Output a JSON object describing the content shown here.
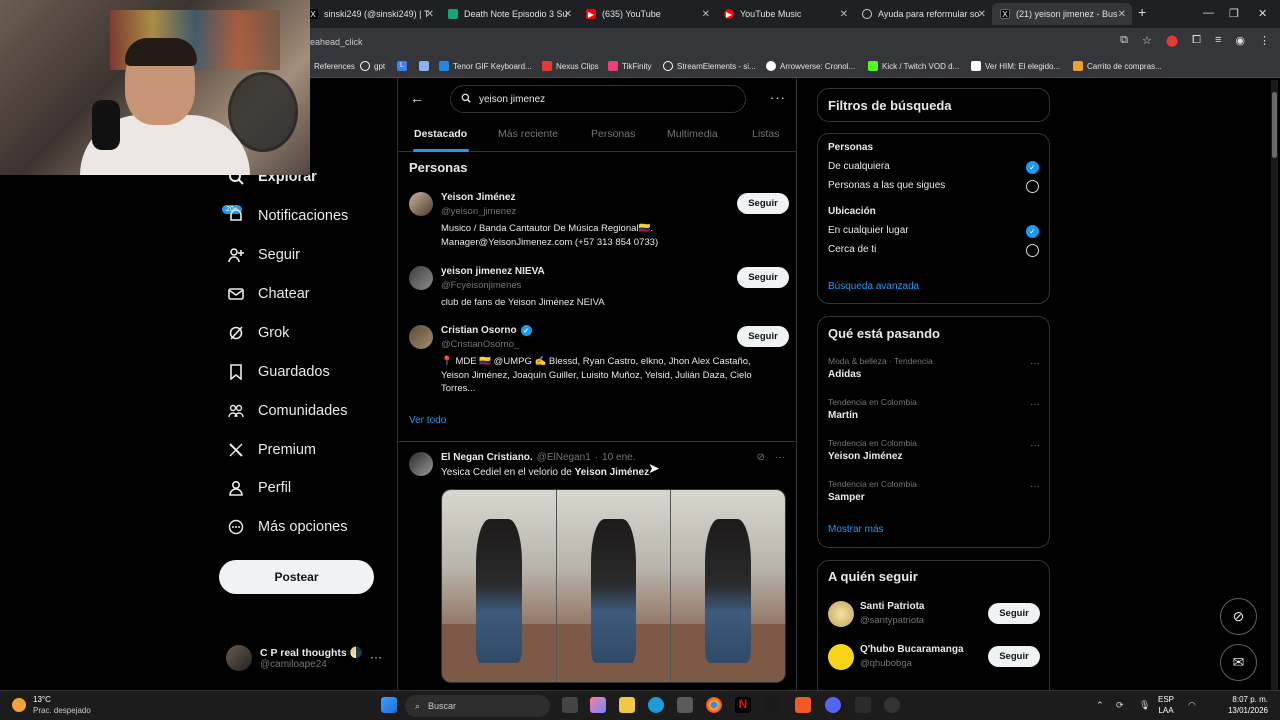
{
  "browser": {
    "tabs": [
      {
        "label": "sinski249 (@sinski249) | T",
        "favicon": "x-icon",
        "color": "#000000"
      },
      {
        "label": "Death Note Episodio 3 Su",
        "favicon": "tv-icon",
        "color": "#1aa37a"
      },
      {
        "label": "(635) YouTube",
        "favicon": "youtube-icon",
        "color": "#ff0000"
      },
      {
        "label": "YouTube Music",
        "favicon": "youtube-music-icon",
        "color": "#ff0000"
      },
      {
        "label": "Ayuda para reformular so",
        "favicon": "chatgpt-icon",
        "color": "#6e6e6e"
      },
      {
        "label": "(21) yeison jimenez - Bus",
        "favicon": "x-icon",
        "color": "#000000"
      }
    ],
    "url": "eahead_click",
    "bookmarks": [
      {
        "label": "References",
        "color": "#4285f4"
      },
      {
        "label": "gpt",
        "color": "#ffffff"
      },
      {
        "label": "L",
        "color": "#3b82f6"
      },
      {
        "label": "",
        "color": "#8ab4f8"
      },
      {
        "label": "Tenor GIF Keyboard...",
        "color": "#1e88e5"
      },
      {
        "label": "Nexus Clips",
        "color": "#e53935"
      },
      {
        "label": "TikFinity",
        "color": "#ec407a"
      },
      {
        "label": "StreamElements - si...",
        "color": "#ffffff"
      },
      {
        "label": "Arrowverse: Cronol...",
        "color": "#ffffff"
      },
      {
        "label": "Kick / Twitch VOD d...",
        "color": "#53fc18"
      },
      {
        "label": "Ver HIM: El elegido...",
        "color": "#ffffff"
      },
      {
        "label": "Carrito de compras...",
        "color": "#f0a030"
      }
    ]
  },
  "nav": {
    "items": [
      {
        "label": "Explorar",
        "icon": "search-icon"
      },
      {
        "label": "Notificaciones",
        "icon": "bell-icon",
        "badge": "20+"
      },
      {
        "label": "Seguir",
        "icon": "add-person-icon"
      },
      {
        "label": "Chatear",
        "icon": "mail-icon"
      },
      {
        "label": "Grok",
        "icon": "grok-icon"
      },
      {
        "label": "Guardados",
        "icon": "bookmark-icon"
      },
      {
        "label": "Comunidades",
        "icon": "communities-icon"
      },
      {
        "label": "Premium",
        "icon": "x-logo-icon"
      },
      {
        "label": "Perfil",
        "icon": "person-icon"
      },
      {
        "label": "Más opciones",
        "icon": "more-circle-icon"
      }
    ],
    "post_label": "Postear",
    "account": {
      "name": "C P real thoughts 🌗",
      "handle": "@camiloape24"
    }
  },
  "search": {
    "query": "yeison jimenez",
    "tabs": [
      "Destacado",
      "Más reciente",
      "Personas",
      "Multimedia",
      "Listas"
    ],
    "active_tab": "Destacado"
  },
  "people_section": {
    "title": "Personas",
    "follow_label": "Seguir",
    "people": [
      {
        "name": "Yeison Jiménez",
        "handle": "@yeison_jimenez",
        "verified": false,
        "bio_lines": [
          "Musico / Banda Cantautor De Música Regional🇨🇴.",
          "Manager@YeisonJimenez.com (+57 313 854 0733)"
        ]
      },
      {
        "name": "yeison jimenez NIEVA",
        "handle": "@Fcyeisonjimenes",
        "verified": false,
        "bio_lines": [
          "club de fans de Yeison Jiménez NEIVA"
        ]
      },
      {
        "name": "Cristian Osorno",
        "handle": "@CristianOsorno_",
        "verified": true,
        "bio_lines": [
          "📍 MDE 🇨🇴 @UMPG ✍️ Blessd, Ryan Castro, elkno, Jhon Alex Castaño,",
          "Yeison Jiménez, Joaquín Guiller, Luisito Muñoz, Yelsid, Julián Daza, Cielo",
          "Torres..."
        ]
      }
    ],
    "see_all": "Ver todo"
  },
  "tweet": {
    "name": "El Negan Cristiano.",
    "handle": "@ElNegan1",
    "time": "10 ene.",
    "text_prefix": "Yesica Cediel en el velorio de",
    "text_bold": "Yeison Jiménez"
  },
  "filters": {
    "title": "Filtros de búsqueda",
    "people_title": "Personas",
    "people_options": [
      {
        "label": "De cualquiera",
        "selected": true
      },
      {
        "label": "Personas a las que sigues",
        "selected": false
      }
    ],
    "location_title": "Ubicación",
    "location_options": [
      {
        "label": "En cualquier lugar",
        "selected": true
      },
      {
        "label": "Cerca de ti",
        "selected": false
      }
    ],
    "advanced": "Búsqueda avanzada"
  },
  "trends": {
    "title": "Qué está pasando",
    "items": [
      {
        "category": "Moda & belleza · Tendencia",
        "name": "Adidas"
      },
      {
        "category": "Tendencia en Colombia",
        "name": "Martín"
      },
      {
        "category": "Tendencia en Colombia",
        "name": "Yeison Jiménez"
      },
      {
        "category": "Tendencia en Colombia",
        "name": "Samper"
      }
    ],
    "show_more": "Mostrar más"
  },
  "who_to_follow": {
    "title": "A quién seguir",
    "follow_label": "Seguir",
    "accounts": [
      {
        "name": "Santi Patriota",
        "handle": "@santypatriota"
      },
      {
        "name": "Q'hubo Bucaramanga",
        "handle": "@qhubobga"
      }
    ]
  },
  "taskbar": {
    "temp": "13°C",
    "weather": "Prac. despejado",
    "search_placeholder": "Buscar",
    "lang_top": "ESP",
    "lang_bottom": "LAA",
    "time": "8:07 p. m.",
    "date": "13/01/2026"
  },
  "colors": {
    "accent": "#1d9bf0",
    "background": "#000000",
    "border": "#2f3336"
  }
}
